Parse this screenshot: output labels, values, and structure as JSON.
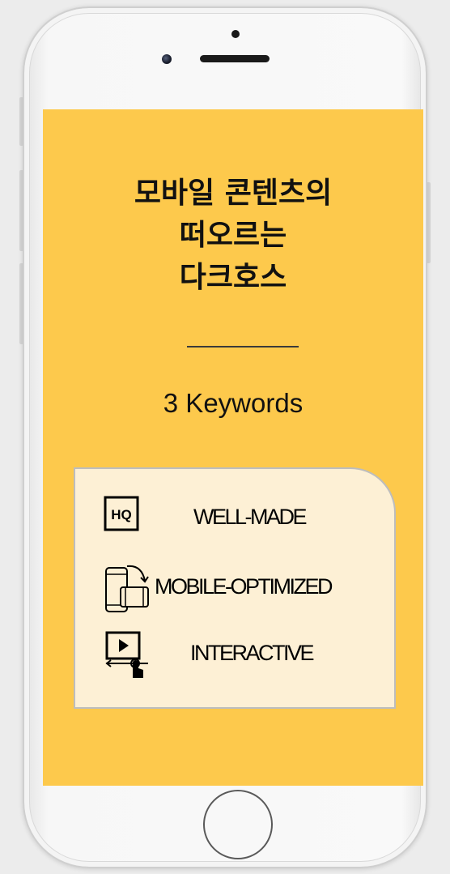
{
  "title_lines": [
    "모바일 콘텐츠의",
    "떠오르는",
    "다크호스"
  ],
  "subtitle": "3 Keywords",
  "keywords": [
    {
      "icon": "hq-icon",
      "label": "WELL-MADE"
    },
    {
      "icon": "phone-rotate-icon",
      "label": "MOBILE-OPTIMIZED"
    },
    {
      "icon": "interactive-video-icon",
      "label": "INTERACTIVE"
    }
  ],
  "hq_icon_text": "HQ",
  "colors": {
    "screen_background": "#fdc94c",
    "card_background": "#fdf0d5",
    "text": "#111111"
  }
}
